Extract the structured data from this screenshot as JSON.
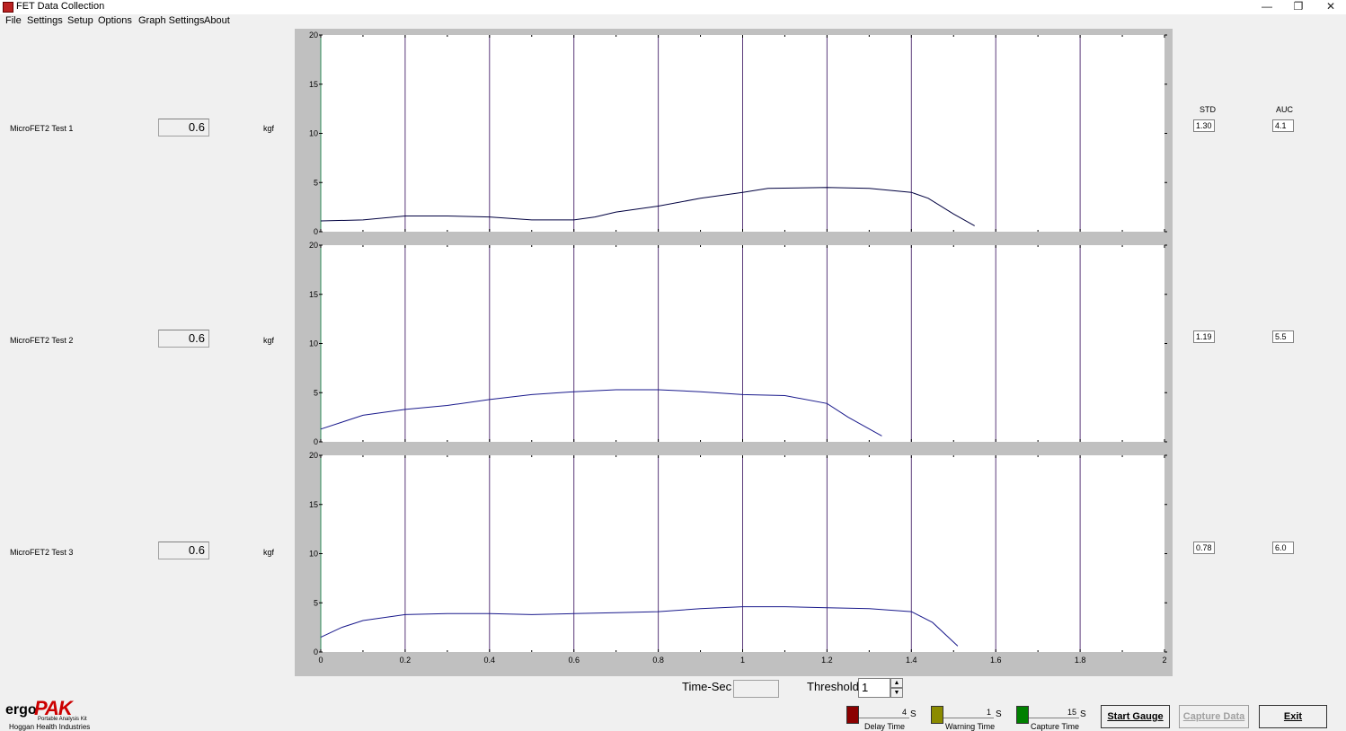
{
  "window": {
    "title": "FET Data Collection"
  },
  "menu": [
    "File",
    "Settings",
    "Setup",
    "Options",
    "Graph Settings",
    "About"
  ],
  "tests": [
    {
      "label": "MicroFET2 Test 1",
      "value": "0.6",
      "unit": "kgf",
      "std": "1.30",
      "auc": "4.1"
    },
    {
      "label": "MicroFET2 Test 2",
      "value": "0.6",
      "unit": "kgf",
      "std": "1.19",
      "auc": "5.5"
    },
    {
      "label": "MicroFET2 Test 3",
      "value": "0.6",
      "unit": "kgf",
      "std": "0.78",
      "auc": "6.0"
    }
  ],
  "stats": {
    "std_header": "STD",
    "auc_header": "AUC"
  },
  "bottom": {
    "time_label": "Time-Sec",
    "threshold_label": "Threshold",
    "threshold_value": "1",
    "delay": {
      "value": "4",
      "unit": "S",
      "name": "Delay Time",
      "color": "#8b0000"
    },
    "warning": {
      "value": "1",
      "unit": "S",
      "name": "Warning Time",
      "color": "#8b8b00"
    },
    "capture": {
      "value": "15",
      "unit": "S",
      "name": "Capture Time",
      "color": "#008000"
    },
    "start_label": "Start Gauge",
    "capture_label": "Capture Data",
    "exit_label": "Exit"
  },
  "logo": {
    "ergo": "ergo",
    "pak": "PAK",
    "tagline": "Portable Analysis Kit",
    "company": "Hoggan Health Industries"
  },
  "chart_data": {
    "type": "line",
    "x_ticks": [
      "0",
      "0.2",
      "0.4",
      "0.6",
      "0.8",
      "1",
      "1.2",
      "1.4",
      "1.6",
      "1.8",
      "2"
    ],
    "y_ticks": [
      "0",
      "5",
      "10",
      "15",
      "20"
    ],
    "xlim": [
      0,
      2
    ],
    "ylim": [
      0,
      20
    ],
    "grid": true,
    "series": [
      {
        "x": [
          0,
          0.1,
          0.2,
          0.3,
          0.4,
          0.5,
          0.6,
          0.65,
          0.7,
          0.8,
          0.9,
          1.0,
          1.06,
          1.2,
          1.3,
          1.4,
          1.44,
          1.5,
          1.55
        ],
        "y": [
          1.1,
          1.2,
          1.6,
          1.6,
          1.5,
          1.2,
          1.2,
          1.5,
          2.0,
          2.6,
          3.4,
          4.0,
          4.4,
          4.5,
          4.4,
          4.0,
          3.4,
          1.8,
          0.6
        ]
      },
      {
        "x": [
          0,
          0.05,
          0.1,
          0.2,
          0.3,
          0.4,
          0.5,
          0.6,
          0.7,
          0.8,
          0.9,
          1.0,
          1.1,
          1.2,
          1.25,
          1.33
        ],
        "y": [
          1.3,
          2.0,
          2.7,
          3.3,
          3.7,
          4.3,
          4.8,
          5.1,
          5.3,
          5.3,
          5.1,
          4.8,
          4.7,
          3.9,
          2.5,
          0.6
        ]
      },
      {
        "x": [
          0,
          0.05,
          0.1,
          0.2,
          0.3,
          0.4,
          0.5,
          0.6,
          0.7,
          0.8,
          0.9,
          1.0,
          1.1,
          1.2,
          1.3,
          1.4,
          1.45,
          1.51
        ],
        "y": [
          1.5,
          2.5,
          3.2,
          3.8,
          3.9,
          3.9,
          3.8,
          3.9,
          4.0,
          4.1,
          4.4,
          4.6,
          4.6,
          4.5,
          4.4,
          4.1,
          3.0,
          0.6
        ]
      }
    ]
  }
}
